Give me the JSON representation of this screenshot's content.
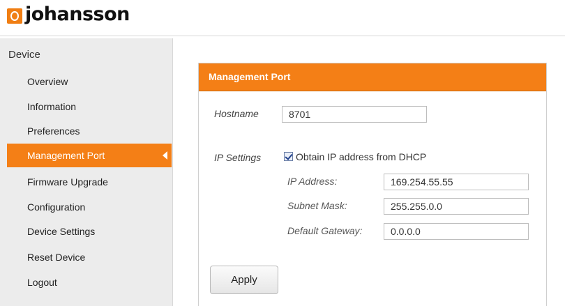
{
  "brand": {
    "name": "johansson",
    "accent_color": "#f47f16"
  },
  "sidebar": {
    "title": "Device",
    "items": [
      {
        "label": "Overview"
      },
      {
        "label": "Information"
      },
      {
        "label": "Preferences"
      },
      {
        "label": "Management Port",
        "active": true
      },
      {
        "label": "Firmware Upgrade"
      },
      {
        "label": "Configuration"
      },
      {
        "label": "Device Settings"
      },
      {
        "label": "Reset Device"
      },
      {
        "label": "Logout"
      }
    ]
  },
  "panel": {
    "title": "Management Port",
    "hostname": {
      "label": "Hostname",
      "value": "8701"
    },
    "ip_settings": {
      "label": "IP Settings",
      "dhcp": {
        "label": "Obtain IP address from DHCP",
        "checked": true
      },
      "ip_address": {
        "label": "IP Address:",
        "value": "169.254.55.55"
      },
      "subnet_mask": {
        "label": "Subnet Mask:",
        "value": "255.255.0.0"
      },
      "default_gateway": {
        "label": "Default Gateway:",
        "value": "0.0.0.0"
      }
    },
    "apply_label": "Apply"
  }
}
